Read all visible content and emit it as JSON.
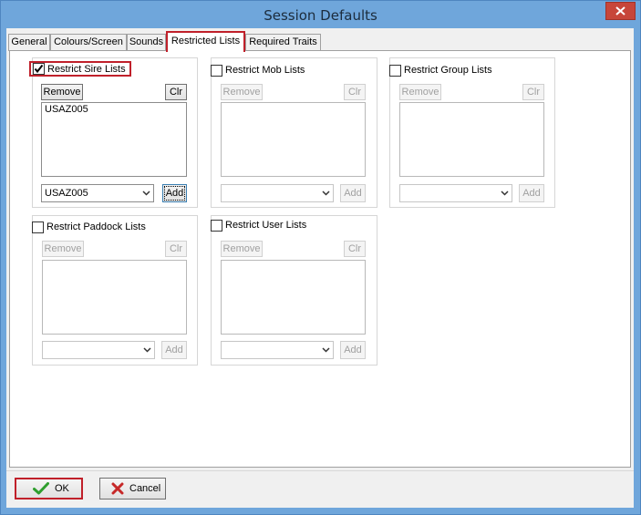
{
  "window": {
    "title": "Session Defaults"
  },
  "tabs": [
    {
      "label": "General"
    },
    {
      "label": "Colours/Screen"
    },
    {
      "label": "Sounds"
    },
    {
      "label": "Restricted Lists"
    },
    {
      "label": "Required Traits"
    }
  ],
  "groups": {
    "sire": {
      "label": "Restrict Sire Lists",
      "checked": true,
      "remove": "Remove",
      "clear": "Clr",
      "items": [
        "USAZ005"
      ],
      "combo_value": "USAZ005",
      "add": "Add"
    },
    "mob": {
      "label": "Restrict Mob Lists",
      "checked": false,
      "remove": "Remove",
      "clear": "Clr",
      "combo_value": "",
      "add": "Add"
    },
    "group": {
      "label": "Restrict Group Lists",
      "checked": false,
      "remove": "Remove",
      "clear": "Clr",
      "combo_value": "",
      "add": "Add"
    },
    "paddock": {
      "label": "Restrict Paddock Lists",
      "checked": false,
      "remove": "Remove",
      "clear": "Clr",
      "combo_value": "",
      "add": "Add"
    },
    "user": {
      "label": "Restrict User Lists",
      "checked": false,
      "remove": "Remove",
      "clear": "Clr",
      "combo_value": "",
      "add": "Add"
    }
  },
  "footer": {
    "ok_label": "OK",
    "cancel_label": "Cancel"
  },
  "colors": {
    "accent_highlight": "#c0202a",
    "title_bar": "#6fa6db",
    "close_button": "#c7463a",
    "ok_check": "#2e9e2e",
    "cancel_x": "#c62828"
  }
}
